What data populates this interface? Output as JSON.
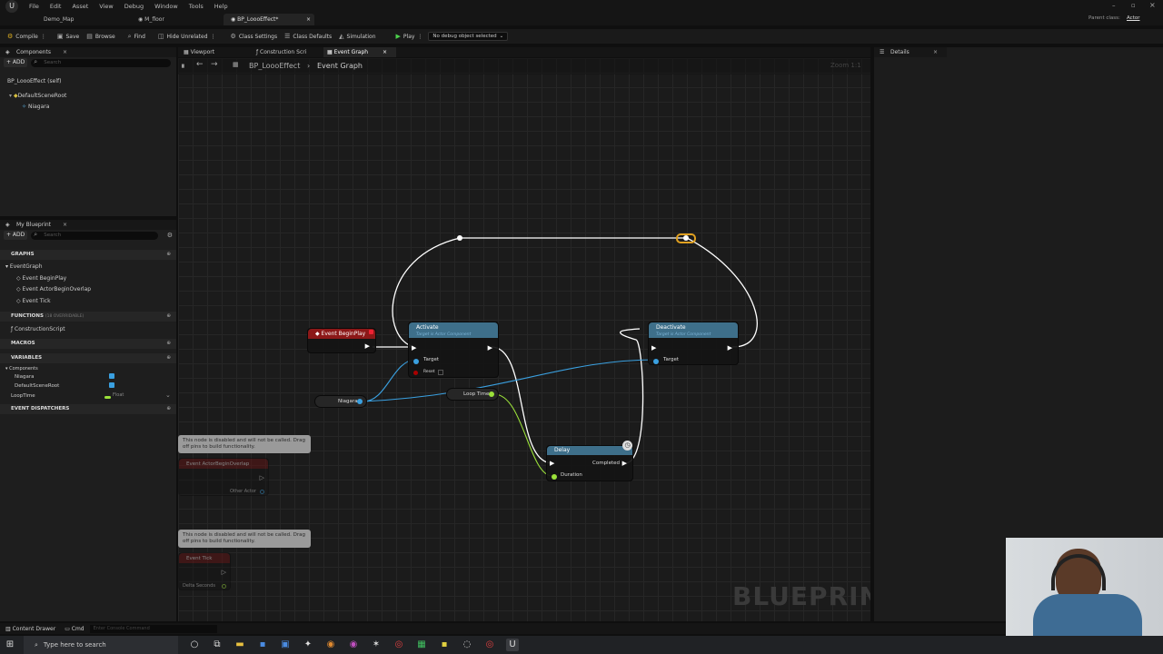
{
  "menu": [
    "File",
    "Edit",
    "Asset",
    "View",
    "Debug",
    "Window",
    "Tools",
    "Help"
  ],
  "tabs": [
    {
      "label": "Demo_Map"
    },
    {
      "label": "M_floor"
    },
    {
      "label": "BP_LoooEffect*"
    }
  ],
  "parent_class": {
    "label": "Parent class:",
    "value": "Actor"
  },
  "toolbar": {
    "compile": "Compile",
    "save": "Save",
    "browse": "Browse",
    "find": "Find",
    "hide_unrelated": "Hide Unrelated",
    "class_settings": "Class Settings",
    "class_defaults": "Class Defaults",
    "simulation": "Simulation",
    "play": "Play",
    "debug_select": "No debug object selected"
  },
  "components_panel": {
    "title": "Components",
    "add": "+ ADD",
    "search_placeholder": "Search",
    "items": [
      "BP_LoooEffect (self)",
      "DefaultSceneRoot",
      "Niagara"
    ]
  },
  "editor_tabs": [
    "Viewport",
    "Construction Scri",
    "Event Graph"
  ],
  "breadcrumb": {
    "root": "BP_LoooEffect",
    "current": "Event Graph",
    "zoom": "Zoom 1:1"
  },
  "details_panel": {
    "title": "Details"
  },
  "my_blueprint": {
    "title": "My Blueprint",
    "add": "+ ADD",
    "search_placeholder": "Search",
    "graphs_label": "GRAPHS",
    "graphs": [
      "EventGraph",
      "Event BeginPlay",
      "Event ActorBeginOverlap",
      "Event Tick"
    ],
    "functions_label": "FUNCTIONS",
    "functions_count": "(18 OVERRIDABLE)",
    "functions": [
      "ConstructionScript"
    ],
    "macros_label": "MACROS",
    "variables_label": "VARIABLES",
    "variable_group": "Components",
    "variables": [
      "Niagara",
      "DefaultSceneRoot"
    ],
    "loop_var": {
      "name": "LoopTime",
      "type": "Float"
    },
    "dispatchers_label": "EVENT DISPATCHERS"
  },
  "nodes": {
    "begin_play": {
      "title": "Event BeginPlay"
    },
    "activate": {
      "title": "Activate",
      "subtitle": "Target is Actor Component",
      "pin_target": "Target",
      "pin_reset": "Reset"
    },
    "deactivate": {
      "title": "Deactivate",
      "subtitle": "Target is Actor Component",
      "pin_target": "Target"
    },
    "niagara_var": {
      "title": "Niagara"
    },
    "loop_time_var": {
      "title": "Loop Time"
    },
    "delay": {
      "title": "Delay",
      "pin_completed": "Completed",
      "pin_duration": "Duration"
    },
    "overlap": {
      "note": "This node is disabled and will not be called. Drag off pins to build functionality.",
      "title": "Event ActorBeginOverlap",
      "pin": "Other Actor"
    },
    "tick": {
      "note": "This node is disabled and will not be called. Drag off pins to build functionality.",
      "title": "Event Tick",
      "pin": "Delta Seconds"
    }
  },
  "watermark": "BLUEPRINT",
  "statusbar": {
    "content_drawer": "Content Drawer",
    "cmd": "Cmd",
    "console_placeholder": "Enter Console Command"
  },
  "taskbar": {
    "search_placeholder": "Type here to search"
  },
  "colors": {
    "exec": "#ffffff",
    "object_pin": "#3aa0e0",
    "float_pin": "#9be13a",
    "event_head": "#8c1818",
    "call_head": "#3e6f8a"
  }
}
